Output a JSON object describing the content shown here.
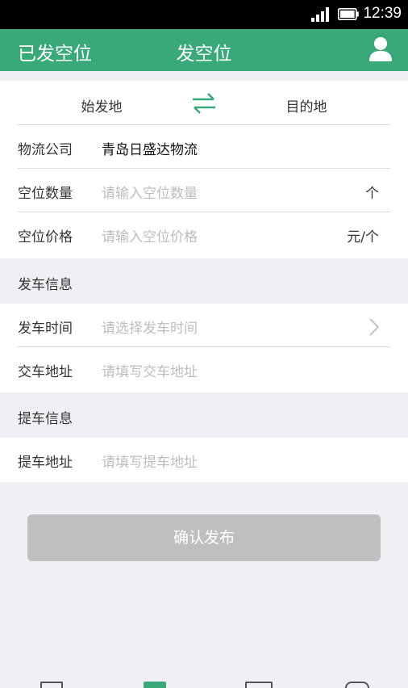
{
  "status": {
    "time": "12:39"
  },
  "appbar": {
    "left_title": "已发空位",
    "title": "发空位"
  },
  "route": {
    "from": "始发地",
    "to": "目的地"
  },
  "company": {
    "label": "物流公司",
    "value": "青岛日盛达物流"
  },
  "slot_count": {
    "label": "空位数量",
    "placeholder": "请输入空位数量",
    "unit": "个"
  },
  "slot_price": {
    "label": "空位价格",
    "placeholder": "请输入空位价格",
    "unit": "元/个"
  },
  "departure_section": {
    "title": "发车信息"
  },
  "departure_time": {
    "label": "发车时间",
    "placeholder": "请选择发车时间"
  },
  "delivery_address": {
    "label": "交车地址",
    "placeholder": "请填写交车地址"
  },
  "pickup_section": {
    "title": "提车信息"
  },
  "pickup_address": {
    "label": "提车地址",
    "placeholder": "请填写提车地址"
  },
  "confirm": {
    "label": "确认发布"
  },
  "colors": {
    "brand": "#3aa97a",
    "button_disabled": "#bfbfbf",
    "background": "#efeff4"
  }
}
